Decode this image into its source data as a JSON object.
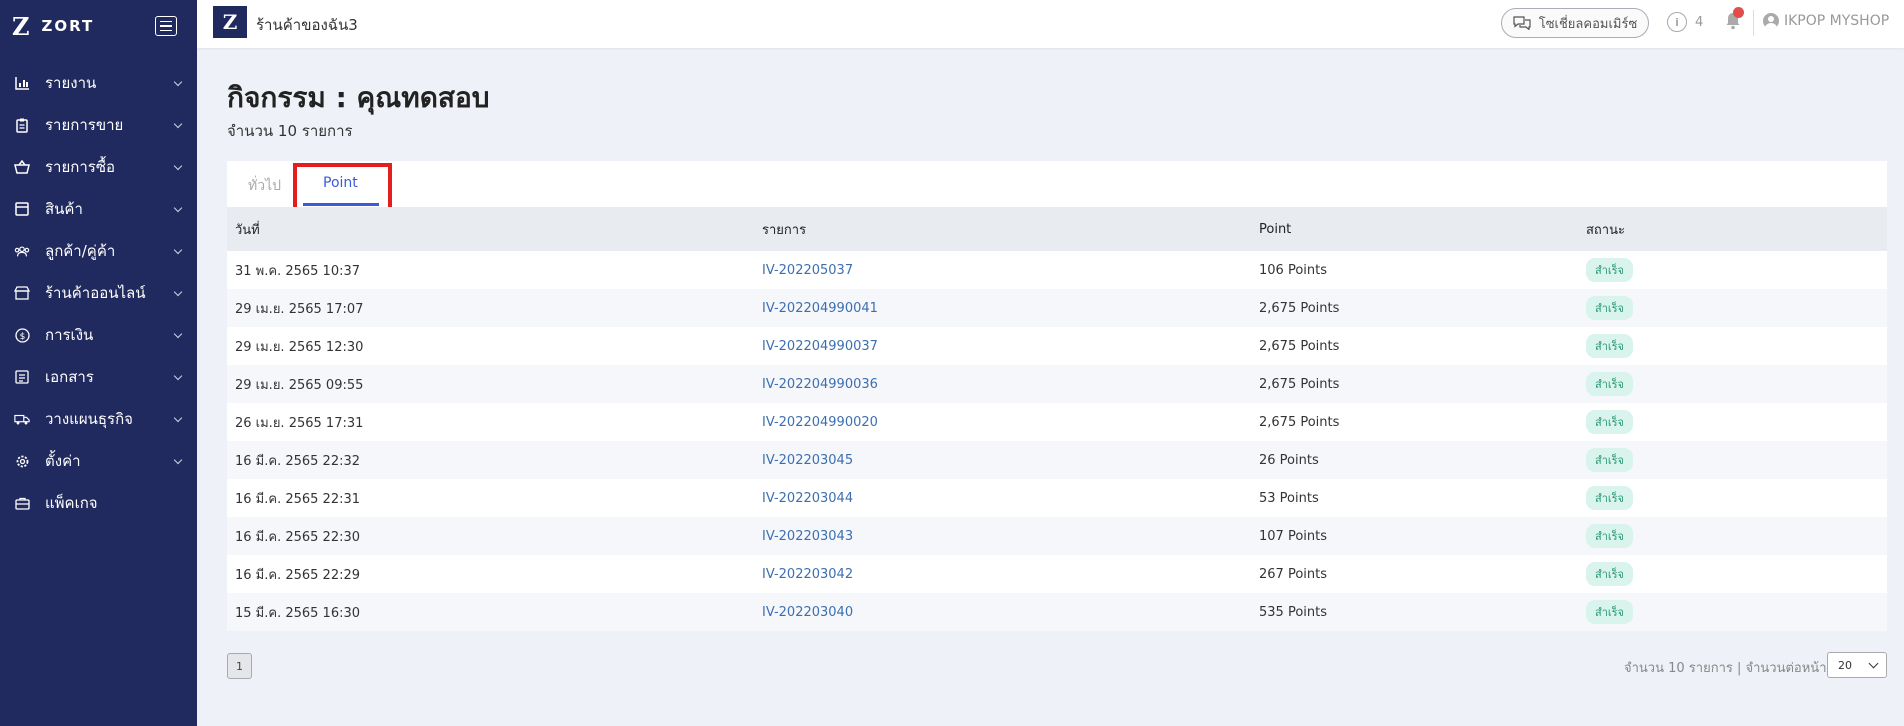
{
  "sidebar": {
    "logo_mark": "Z",
    "brand": "ZORT",
    "items": [
      {
        "label": "รายงาน",
        "icon": "chart-icon"
      },
      {
        "label": "รายการขาย",
        "icon": "clipboard-icon"
      },
      {
        "label": "รายการซื้อ",
        "icon": "basket-icon"
      },
      {
        "label": "สินค้า",
        "icon": "box-icon"
      },
      {
        "label": "ลูกค้า/คู่ค้า",
        "icon": "users-icon"
      },
      {
        "label": "ร้านค้าออนไลน์",
        "icon": "store-icon"
      },
      {
        "label": "การเงิน",
        "icon": "dollar-icon"
      },
      {
        "label": "เอกสาร",
        "icon": "document-icon"
      },
      {
        "label": "วางแผนธุรกิจ",
        "icon": "truck-icon"
      },
      {
        "label": "ตั้งค่า",
        "icon": "gear-icon"
      },
      {
        "label": "แพ็คเกจ",
        "icon": "briefcase-icon"
      }
    ]
  },
  "topbar": {
    "shop_logo": "Z",
    "shop_name": "ร้านค้าของฉัน3",
    "social_button": "โซเชี่ยลคอมเมิร์ซ",
    "info_count": "4",
    "user_name": "IKPOP MYSHOP"
  },
  "page": {
    "title": "กิจกรรม : คุณทดสอบ",
    "count": "จำนวน 10 รายการ"
  },
  "tabs": {
    "general": "ทั่วไป",
    "point": "Point"
  },
  "table": {
    "headers": {
      "date": "วันที่",
      "item": "รายการ",
      "point": "Point",
      "status": "สถานะ"
    },
    "rows": [
      {
        "date": "31 พ.ค. 2565 10:37",
        "item": "IV-202205037",
        "point": "106 Points",
        "status": "สำเร็จ"
      },
      {
        "date": "29 เม.ย. 2565 17:07",
        "item": "IV-202204990041",
        "point": "2,675 Points",
        "status": "สำเร็จ"
      },
      {
        "date": "29 เม.ย. 2565 12:30",
        "item": "IV-202204990037",
        "point": "2,675 Points",
        "status": "สำเร็จ"
      },
      {
        "date": "29 เม.ย. 2565 09:55",
        "item": "IV-202204990036",
        "point": "2,675 Points",
        "status": "สำเร็จ"
      },
      {
        "date": "26 เม.ย. 2565 17:31",
        "item": "IV-202204990020",
        "point": "2,675 Points",
        "status": "สำเร็จ"
      },
      {
        "date": "16 มี.ค. 2565 22:32",
        "item": "IV-202203045",
        "point": "26 Points",
        "status": "สำเร็จ"
      },
      {
        "date": "16 มี.ค. 2565 22:31",
        "item": "IV-202203044",
        "point": "53 Points",
        "status": "สำเร็จ"
      },
      {
        "date": "16 มี.ค. 2565 22:30",
        "item": "IV-202203043",
        "point": "107 Points",
        "status": "สำเร็จ"
      },
      {
        "date": "16 มี.ค. 2565 22:29",
        "item": "IV-202203042",
        "point": "267 Points",
        "status": "สำเร็จ"
      },
      {
        "date": "15 มี.ค. 2565 16:30",
        "item": "IV-202203040",
        "point": "535 Points",
        "status": "สำเร็จ"
      }
    ]
  },
  "footer": {
    "page_number": "1",
    "summary": "จำนวน 10 รายการ | จำนวนต่อหน้า",
    "per_page": "20"
  },
  "colors": {
    "sidebar_bg": "#212a5e",
    "accent": "#3b5bdb",
    "link": "#3d6fb0",
    "success_bg": "#d9f4ec",
    "success_text": "#2a9a72",
    "highlight": "#e41d1d"
  }
}
